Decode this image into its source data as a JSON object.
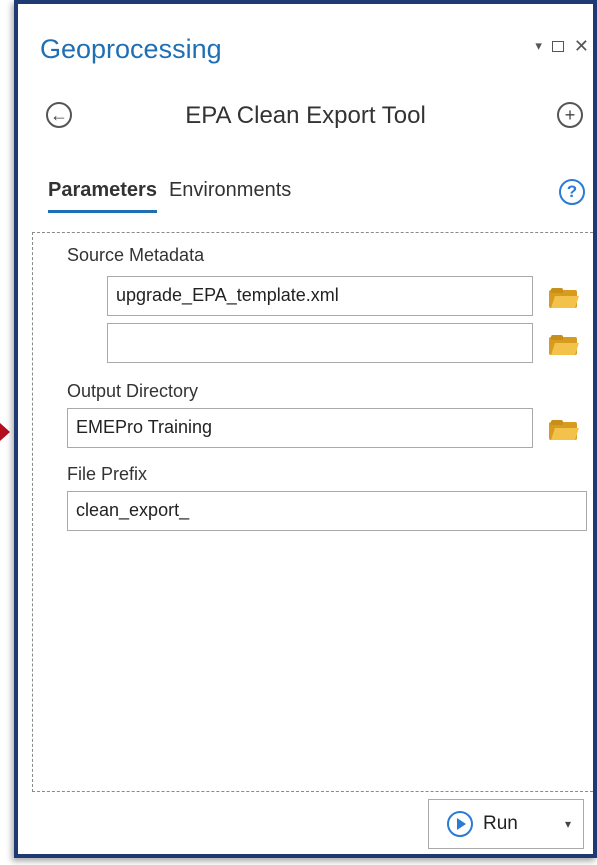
{
  "pane": {
    "title": "Geoprocessing",
    "controls": {
      "pin": "▾",
      "maximize": "",
      "close": "✕"
    }
  },
  "tool": {
    "title": "EPA Clean Export Tool",
    "back_icon": "back-arrow-circle",
    "add_icon": "plus-circle"
  },
  "tabs": [
    {
      "label": "Parameters",
      "active": true
    },
    {
      "label": "Environments",
      "active": false
    }
  ],
  "help": {
    "symbol": "?"
  },
  "parameters": {
    "source_metadata": {
      "label": "Source Metadata",
      "values": [
        "upgrade_EPA_template.xml",
        ""
      ]
    },
    "output_directory": {
      "label": "Output Directory",
      "value": "EMEPro Training"
    },
    "file_prefix": {
      "label": "File Prefix",
      "value": "clean_export_"
    }
  },
  "run": {
    "label": "Run",
    "dropdown_symbol": "▾"
  },
  "colors": {
    "accent": "#1f6fb5",
    "frame_border": "#1f3a73",
    "arrow": "#b30d1e",
    "folder": "#f2c24b"
  }
}
